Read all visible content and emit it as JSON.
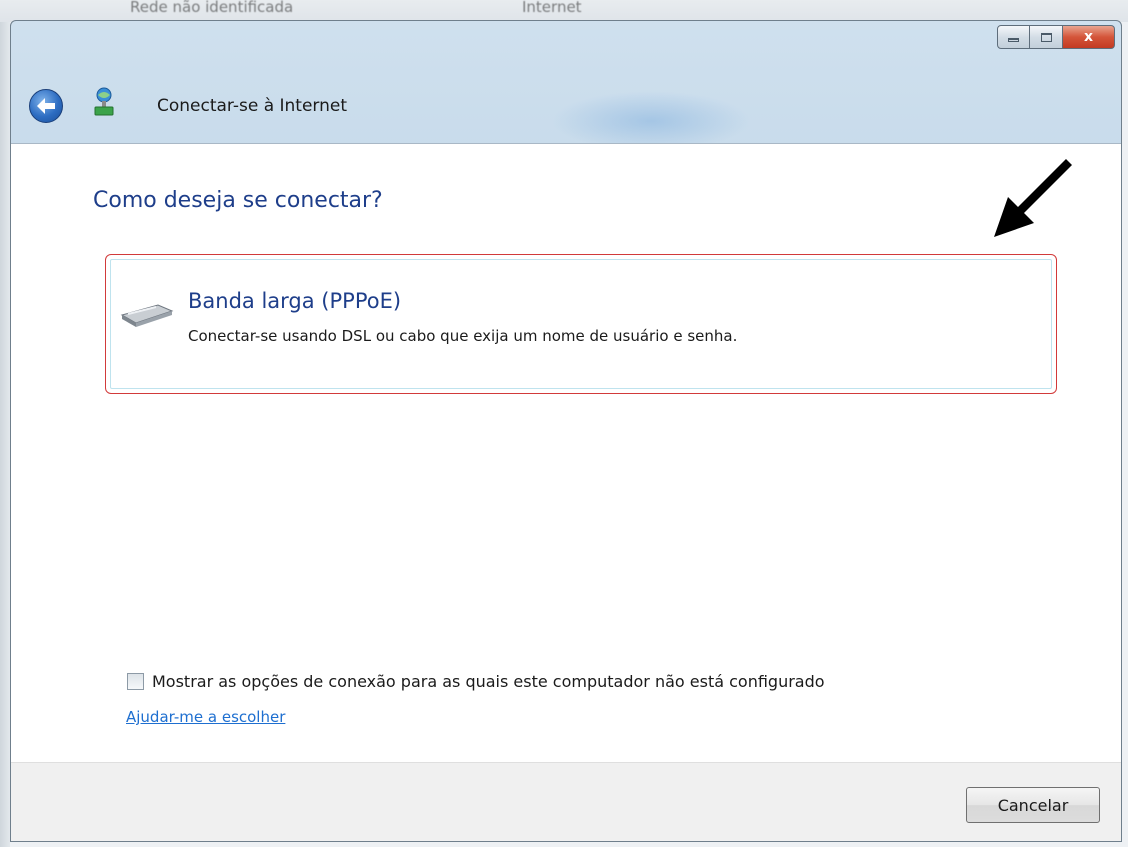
{
  "background": {
    "text_left": "Rede não identificada",
    "text_right": "Internet"
  },
  "window": {
    "title": "Conectar-se à Internet",
    "buttons": {
      "minimize_icon": "minimize-icon",
      "maximize_icon": "maximize-icon",
      "close_icon": "close-icon",
      "close_glyph": "x"
    }
  },
  "content": {
    "heading": "Como deseja se conectar?",
    "option": {
      "icon": "modem-icon",
      "title": "Banda larga (PPPoE)",
      "description": "Conectar-se usando DSL ou cabo que exija um nome de usuário e senha."
    },
    "show_options_checkbox": {
      "checked": false,
      "label": "Mostrar as opções de conexão para as quais este computador não está configurado"
    },
    "help_link": "Ajudar-me a escolher"
  },
  "footer": {
    "cancel_label": "Cancelar"
  },
  "colors": {
    "heading": "#1e3e8a",
    "link": "#1e6fd0",
    "highlight_border": "#d23a3a"
  }
}
